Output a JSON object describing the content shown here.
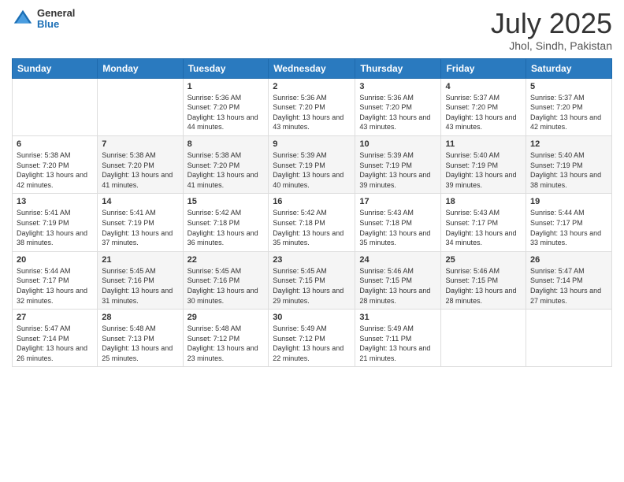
{
  "header": {
    "logo": {
      "general": "General",
      "blue": "Blue"
    },
    "title": "July 2025",
    "location": "Jhol, Sindh, Pakistan"
  },
  "calendar": {
    "days_of_week": [
      "Sunday",
      "Monday",
      "Tuesday",
      "Wednesday",
      "Thursday",
      "Friday",
      "Saturday"
    ],
    "weeks": [
      [
        {
          "day": "",
          "info": ""
        },
        {
          "day": "",
          "info": ""
        },
        {
          "day": "1",
          "info": "Sunrise: 5:36 AM\nSunset: 7:20 PM\nDaylight: 13 hours and 44 minutes."
        },
        {
          "day": "2",
          "info": "Sunrise: 5:36 AM\nSunset: 7:20 PM\nDaylight: 13 hours and 43 minutes."
        },
        {
          "day": "3",
          "info": "Sunrise: 5:36 AM\nSunset: 7:20 PM\nDaylight: 13 hours and 43 minutes."
        },
        {
          "day": "4",
          "info": "Sunrise: 5:37 AM\nSunset: 7:20 PM\nDaylight: 13 hours and 43 minutes."
        },
        {
          "day": "5",
          "info": "Sunrise: 5:37 AM\nSunset: 7:20 PM\nDaylight: 13 hours and 42 minutes."
        }
      ],
      [
        {
          "day": "6",
          "info": "Sunrise: 5:38 AM\nSunset: 7:20 PM\nDaylight: 13 hours and 42 minutes."
        },
        {
          "day": "7",
          "info": "Sunrise: 5:38 AM\nSunset: 7:20 PM\nDaylight: 13 hours and 41 minutes."
        },
        {
          "day": "8",
          "info": "Sunrise: 5:38 AM\nSunset: 7:20 PM\nDaylight: 13 hours and 41 minutes."
        },
        {
          "day": "9",
          "info": "Sunrise: 5:39 AM\nSunset: 7:19 PM\nDaylight: 13 hours and 40 minutes."
        },
        {
          "day": "10",
          "info": "Sunrise: 5:39 AM\nSunset: 7:19 PM\nDaylight: 13 hours and 39 minutes."
        },
        {
          "day": "11",
          "info": "Sunrise: 5:40 AM\nSunset: 7:19 PM\nDaylight: 13 hours and 39 minutes."
        },
        {
          "day": "12",
          "info": "Sunrise: 5:40 AM\nSunset: 7:19 PM\nDaylight: 13 hours and 38 minutes."
        }
      ],
      [
        {
          "day": "13",
          "info": "Sunrise: 5:41 AM\nSunset: 7:19 PM\nDaylight: 13 hours and 38 minutes."
        },
        {
          "day": "14",
          "info": "Sunrise: 5:41 AM\nSunset: 7:19 PM\nDaylight: 13 hours and 37 minutes."
        },
        {
          "day": "15",
          "info": "Sunrise: 5:42 AM\nSunset: 7:18 PM\nDaylight: 13 hours and 36 minutes."
        },
        {
          "day": "16",
          "info": "Sunrise: 5:42 AM\nSunset: 7:18 PM\nDaylight: 13 hours and 35 minutes."
        },
        {
          "day": "17",
          "info": "Sunrise: 5:43 AM\nSunset: 7:18 PM\nDaylight: 13 hours and 35 minutes."
        },
        {
          "day": "18",
          "info": "Sunrise: 5:43 AM\nSunset: 7:17 PM\nDaylight: 13 hours and 34 minutes."
        },
        {
          "day": "19",
          "info": "Sunrise: 5:44 AM\nSunset: 7:17 PM\nDaylight: 13 hours and 33 minutes."
        }
      ],
      [
        {
          "day": "20",
          "info": "Sunrise: 5:44 AM\nSunset: 7:17 PM\nDaylight: 13 hours and 32 minutes."
        },
        {
          "day": "21",
          "info": "Sunrise: 5:45 AM\nSunset: 7:16 PM\nDaylight: 13 hours and 31 minutes."
        },
        {
          "day": "22",
          "info": "Sunrise: 5:45 AM\nSunset: 7:16 PM\nDaylight: 13 hours and 30 minutes."
        },
        {
          "day": "23",
          "info": "Sunrise: 5:45 AM\nSunset: 7:15 PM\nDaylight: 13 hours and 29 minutes."
        },
        {
          "day": "24",
          "info": "Sunrise: 5:46 AM\nSunset: 7:15 PM\nDaylight: 13 hours and 28 minutes."
        },
        {
          "day": "25",
          "info": "Sunrise: 5:46 AM\nSunset: 7:15 PM\nDaylight: 13 hours and 28 minutes."
        },
        {
          "day": "26",
          "info": "Sunrise: 5:47 AM\nSunset: 7:14 PM\nDaylight: 13 hours and 27 minutes."
        }
      ],
      [
        {
          "day": "27",
          "info": "Sunrise: 5:47 AM\nSunset: 7:14 PM\nDaylight: 13 hours and 26 minutes."
        },
        {
          "day": "28",
          "info": "Sunrise: 5:48 AM\nSunset: 7:13 PM\nDaylight: 13 hours and 25 minutes."
        },
        {
          "day": "29",
          "info": "Sunrise: 5:48 AM\nSunset: 7:12 PM\nDaylight: 13 hours and 23 minutes."
        },
        {
          "day": "30",
          "info": "Sunrise: 5:49 AM\nSunset: 7:12 PM\nDaylight: 13 hours and 22 minutes."
        },
        {
          "day": "31",
          "info": "Sunrise: 5:49 AM\nSunset: 7:11 PM\nDaylight: 13 hours and 21 minutes."
        },
        {
          "day": "",
          "info": ""
        },
        {
          "day": "",
          "info": ""
        }
      ]
    ]
  }
}
